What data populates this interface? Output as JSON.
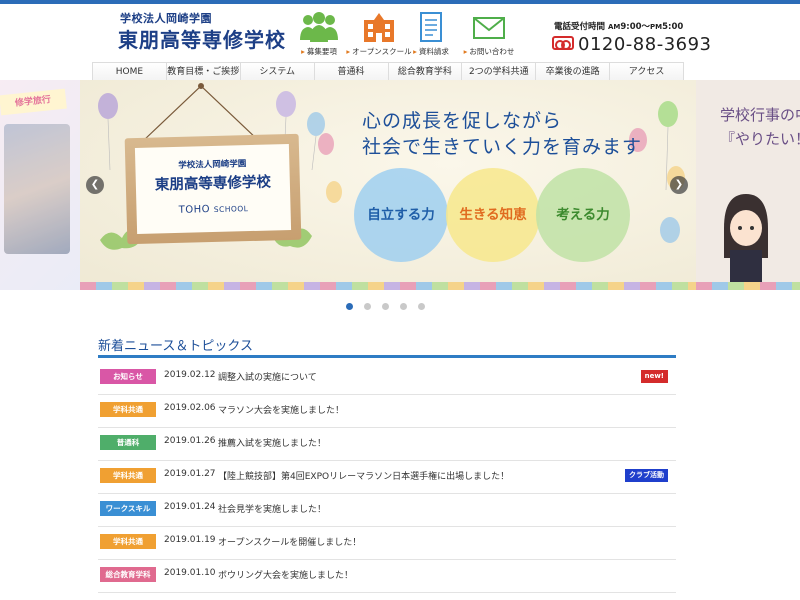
{
  "header": {
    "school_sub": "学校法人岡崎学園",
    "school_name": "東朋高等専修学校",
    "nav": [
      {
        "label": "募集要項",
        "icon": "people-icon"
      },
      {
        "label": "オープンスクール",
        "icon": "school-building-icon"
      },
      {
        "label": "資料請求",
        "icon": "document-icon"
      },
      {
        "label": "お問い合わせ",
        "icon": "mail-icon"
      }
    ],
    "tel_label": "電話受付時間",
    "tel_hours_am": "AM",
    "tel_hours_start": "9:00～",
    "tel_hours_pm": "PM",
    "tel_hours_end": "5:00",
    "tel_number": "0120-88-3693",
    "tel_icon": "freedial-icon"
  },
  "gnav": [
    "HOME",
    "教育目標・ご挨拶",
    "システム",
    "普通科",
    "総合教育学科",
    "2つの学科共通",
    "卒業後の進路",
    "アクセス"
  ],
  "slider": {
    "left_tag": "修学旅行",
    "sign_sub": "学校法人岡崎学園",
    "sign_name": "東朋高等専修学校",
    "sign_en_big": "TOHO",
    "sign_en_small": "SCHOOL",
    "headline_1": "心の成長を促しながら",
    "headline_2": "社会で生きていく力を育みます",
    "circles": [
      "自立する力",
      "生きる知恵",
      "考える力"
    ],
    "right_lines": [
      "学校行事の中",
      "『やりたい！', '取り組める"
    ],
    "prev_icon": "chevron-left-icon",
    "next_icon": "chevron-right-icon",
    "dot_count": 5,
    "active_dot": 0
  },
  "news": {
    "title": "新着ニュース＆トピックス",
    "items": [
      {
        "category": "お知らせ",
        "color": "#d957a6",
        "date": "2019.02.12",
        "title": "調整入試の実施について",
        "badge": "new!",
        "badge_color": "#d42b2b"
      },
      {
        "category": "学科共通",
        "color": "#f0a032",
        "date": "2019.02.06",
        "title": "マラソン大会を実施しました！",
        "badge": "",
        "badge_color": ""
      },
      {
        "category": "普通科",
        "color": "#4fae6a",
        "date": "2019.01.26",
        "title": "推薦入試を実施しました！",
        "badge": "",
        "badge_color": ""
      },
      {
        "category": "学科共通",
        "color": "#f0a032",
        "date": "2019.01.27",
        "title": "【陸上競技部】第4回EXPOリレーマラソン日本選手権に出場しました！",
        "badge": "クラブ活動",
        "badge_color": "#1f3fcc"
      },
      {
        "category": "ワークスキル",
        "color": "#3a8fd4",
        "date": "2019.01.24",
        "title": "社会見学を実施しました！",
        "badge": "",
        "badge_color": ""
      },
      {
        "category": "学科共通",
        "color": "#f0a032",
        "date": "2019.01.19",
        "title": "オープンスクールを開催しました！",
        "badge": "",
        "badge_color": ""
      },
      {
        "category": "総合教育学科",
        "color": "#e06a8f",
        "date": "2019.01.10",
        "title": "ボウリング大会を実施しました！",
        "badge": "",
        "badge_color": ""
      }
    ]
  }
}
